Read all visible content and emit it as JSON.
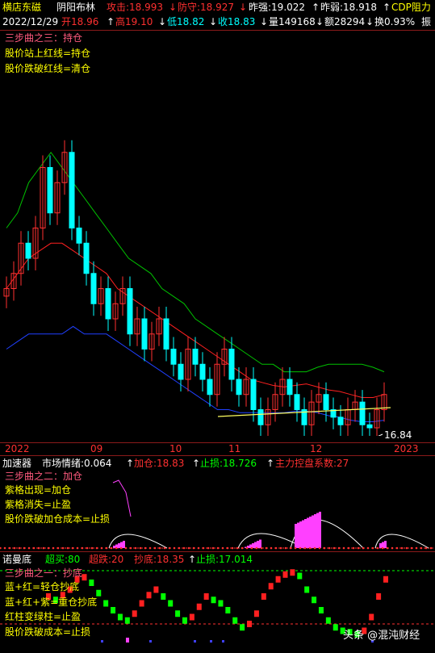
{
  "header": {
    "stock_name": "横店东磁",
    "indicator_name": "阴阳布林",
    "attack": "攻击:18.993",
    "defend": "防守:18.927",
    "prev_strong": "昨强:19.022",
    "prev_weak": "昨弱:18.918",
    "cdp": "CDP阻力"
  },
  "quote": {
    "date": "2022/12/29",
    "open": "开18.96",
    "high": "高19.10",
    "low": "低18.82",
    "close": "收18.83",
    "volume": "量149168",
    "amount": "额28294",
    "turnover": "换0.93%",
    "amplitude": "振"
  },
  "main_notes": {
    "title": "三步曲之三：持仓",
    "line1": "股价站上红线=持仓",
    "line2": "股价跌破红线=清仓"
  },
  "price_label": "16.84",
  "x_axis": {
    "labels": [
      "2022",
      "09",
      "10",
      "11",
      "12",
      "2023"
    ]
  },
  "accel": {
    "title": "加速器",
    "sentiment": "市场情绪:0.064",
    "add": "加仓:18.83",
    "stop": "止损:18.726",
    "force": "主力控盘系数:27",
    "notes_title": "三步曲之二：加仓",
    "n1": "紫格出现=加仓",
    "n2": "紫格消失=止盈",
    "n3": "股价跌破加仓成本=止损"
  },
  "bottom": {
    "title": "诺曼底",
    "overbuy": "超买:80",
    "oversell": "超跌:20",
    "bottom_buy": "抄底:18.35",
    "stop": "止损:17.014",
    "notes_title": "三步曲之一：抄底",
    "n1": "蓝+红=轻仓抄底",
    "n2": "蓝+红+紫=重仓抄底",
    "n3": "红柱变绿柱=止盈",
    "n4": "股价跌破成本=止损"
  },
  "watermark": "头条 @混沌财经",
  "colors": {
    "up": "#ff3030",
    "down": "#00ffff",
    "mid": "#ff2020",
    "upper": "#00c000",
    "lower": "#2040ff",
    "grid": "#8b1a1a"
  },
  "chart_data": [
    {
      "type": "candlestick",
      "title": "阴阳布林",
      "x": [
        "2022",
        "09",
        "10",
        "11",
        "12",
        "2023"
      ],
      "series": [
        {
          "name": "candles",
          "values": [
            26,
            27,
            29,
            28,
            30,
            34,
            31,
            33,
            35,
            30,
            29,
            27,
            25,
            26,
            24,
            25,
            26,
            23,
            24,
            22,
            23,
            24,
            22,
            21,
            20,
            22,
            21,
            20,
            19,
            21,
            22,
            20,
            19,
            20,
            18,
            17,
            18,
            19,
            20,
            19,
            18,
            17,
            18.5,
            19,
            18,
            17.5,
            17,
            18,
            18.5,
            17,
            16.8,
            18,
            19
          ]
        },
        {
          "name": "upper",
          "values": [
            30,
            31,
            33,
            34,
            35,
            34,
            33,
            32,
            31,
            30,
            29,
            28,
            27.5,
            27,
            26,
            25.5,
            25,
            24,
            23.5,
            23,
            22.5,
            22,
            21.5,
            21,
            21,
            20.5,
            20.5,
            20.5,
            20.8,
            21,
            21,
            21,
            21,
            20.8,
            20.5
          ]
        },
        {
          "name": "middle",
          "values": [
            26,
            27,
            28,
            28.5,
            29,
            29,
            28.5,
            28,
            27.5,
            27,
            26,
            25.5,
            25,
            24.5,
            24,
            23.5,
            23,
            22.5,
            22,
            21.5,
            21,
            20.5,
            20,
            19.8,
            19.6,
            19.5,
            19.6,
            19.7,
            19.5,
            19.3,
            19.2,
            19,
            18.8,
            18.8,
            19
          ]
        },
        {
          "name": "lower",
          "values": [
            22,
            22.5,
            23,
            23,
            23,
            23,
            23.5,
            23,
            23,
            23,
            22.5,
            22,
            21.5,
            21,
            20.5,
            20,
            19.5,
            19,
            18.5,
            18,
            18,
            17.8,
            17.8,
            17.8,
            17.8,
            17.8,
            17.9,
            17.9,
            17.8,
            17.6,
            17.5,
            17.3,
            17.2,
            17.2,
            17.3
          ]
        }
      ]
    }
  ]
}
